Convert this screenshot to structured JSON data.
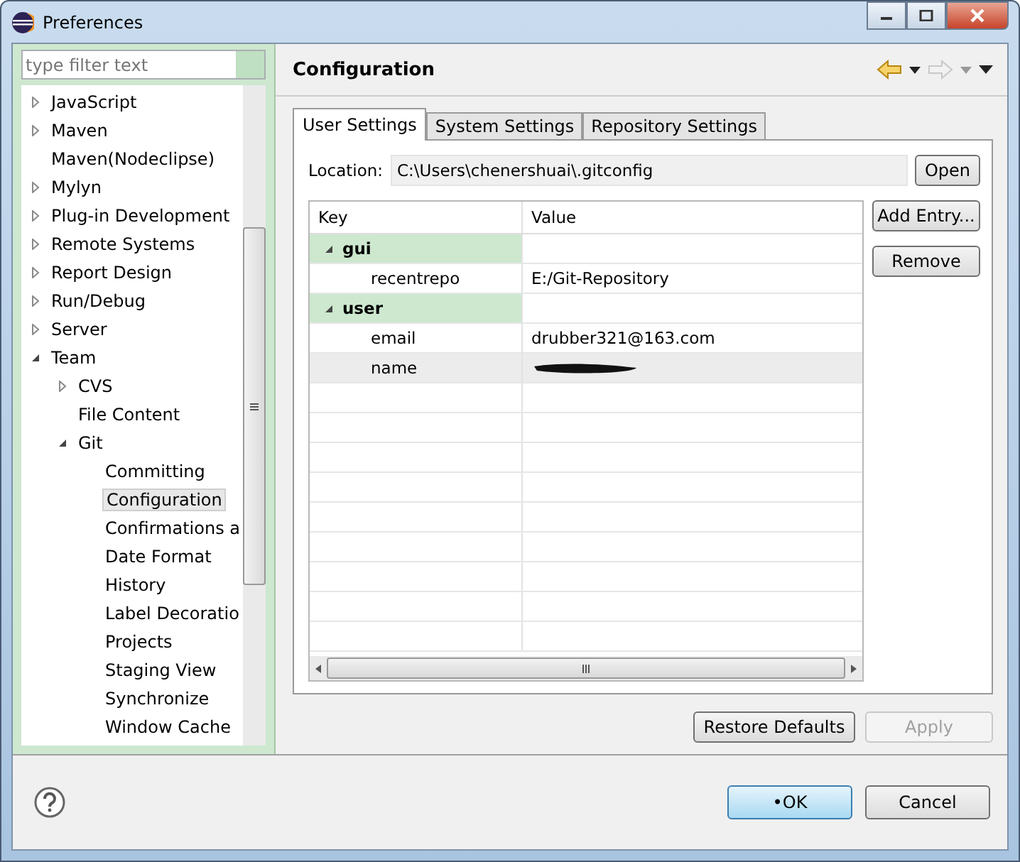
{
  "window": {
    "title": "Preferences"
  },
  "filter": {
    "placeholder": "type filter text"
  },
  "tree": [
    {
      "label": "JavaScript",
      "expanded": false,
      "selected": false
    },
    {
      "label": "Maven",
      "expanded": false,
      "selected": false
    },
    {
      "label": "Maven(Nodeclipse)",
      "selected": false
    },
    {
      "label": "Mylyn",
      "expanded": false,
      "selected": false
    },
    {
      "label": "Plug-in Development",
      "expanded": false,
      "selected": false
    },
    {
      "label": "Remote Systems",
      "expanded": false,
      "selected": false
    },
    {
      "label": "Report Design",
      "expanded": false,
      "selected": false
    },
    {
      "label": "Run/Debug",
      "expanded": false,
      "selected": false
    },
    {
      "label": "Server",
      "expanded": false,
      "selected": false
    },
    {
      "label": "Team",
      "expanded": true,
      "selected": false,
      "children": [
        {
          "label": "CVS",
          "expanded": false,
          "selected": false
        },
        {
          "label": "File Content",
          "selected": false
        },
        {
          "label": "Git",
          "expanded": true,
          "selected": false,
          "children": [
            {
              "label": "Committing",
              "selected": false
            },
            {
              "label": "Configuration",
              "selected": true
            },
            {
              "label": "Confirmations a",
              "selected": false
            },
            {
              "label": "Date Format",
              "selected": false
            },
            {
              "label": "History",
              "selected": false
            },
            {
              "label": "Label Decoratio",
              "selected": false
            },
            {
              "label": "Projects",
              "selected": false
            },
            {
              "label": "Staging View",
              "selected": false
            },
            {
              "label": "Synchronize",
              "selected": false
            },
            {
              "label": "Window Cache",
              "selected": false
            }
          ]
        }
      ]
    }
  ],
  "page": {
    "title": "Configuration"
  },
  "tabs": [
    {
      "label": "User Settings",
      "selected": true
    },
    {
      "label": "System Settings",
      "selected": false
    },
    {
      "label": "Repository Settings",
      "selected": false
    }
  ],
  "location": {
    "label": "Location:",
    "value": "C:\\Users\\chenershuai\\.gitconfig",
    "button": "Open"
  },
  "table": {
    "columns": [
      "Key",
      "Value"
    ],
    "rows": [
      {
        "kind": "section",
        "key": "gui",
        "selected": false
      },
      {
        "kind": "entry",
        "key": "recentrepo",
        "value": "E:/Git-Repository",
        "selected": false
      },
      {
        "kind": "section",
        "key": "user",
        "selected": false
      },
      {
        "kind": "entry",
        "key": "email",
        "value": "drubber321@163.com",
        "selected": false
      },
      {
        "kind": "entry",
        "key": "name",
        "redacted": true,
        "selected": true
      }
    ]
  },
  "side_buttons": [
    "Add Entry...",
    "Remove"
  ],
  "page_buttons": [
    {
      "label": "Restore Defaults",
      "disabled": false
    },
    {
      "label": "Apply",
      "disabled": true
    }
  ],
  "dialog_buttons": [
    {
      "label": "•OK",
      "default": true
    },
    {
      "label": "Cancel",
      "default": false
    }
  ]
}
